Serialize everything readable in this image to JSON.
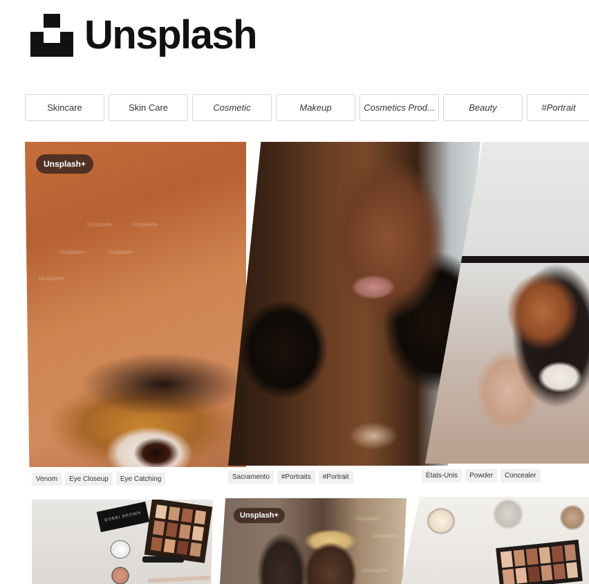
{
  "brand": {
    "name": "Unsplash"
  },
  "chips": [
    "Skincare",
    "Skin Care",
    "Cosmetic",
    "Makeup",
    "Cosmetics Prod...",
    "Beauty",
    "#Portrait"
  ],
  "cards": [
    {
      "badge": "Unsplash+",
      "tags": [
        "Venom",
        "Eye Closeup",
        "Eye Catching"
      ],
      "watermark": "Unsplash+"
    },
    {
      "tags": [
        "Sacramento",
        "#Portraits",
        "#Portrait"
      ]
    },
    {
      "tags": [
        "États-Unis",
        "Powder",
        "Concealer"
      ]
    },
    {
      "brand_box": "BOBBI BROWN"
    },
    {
      "badge": "Unsplash+",
      "watermark": "Unsplash+"
    },
    {}
  ],
  "colors": {
    "text": "#111111",
    "chip_border": "#d4d4d4",
    "tag_bg": "#f0f0f0",
    "badge_bg": "#3c281e"
  }
}
